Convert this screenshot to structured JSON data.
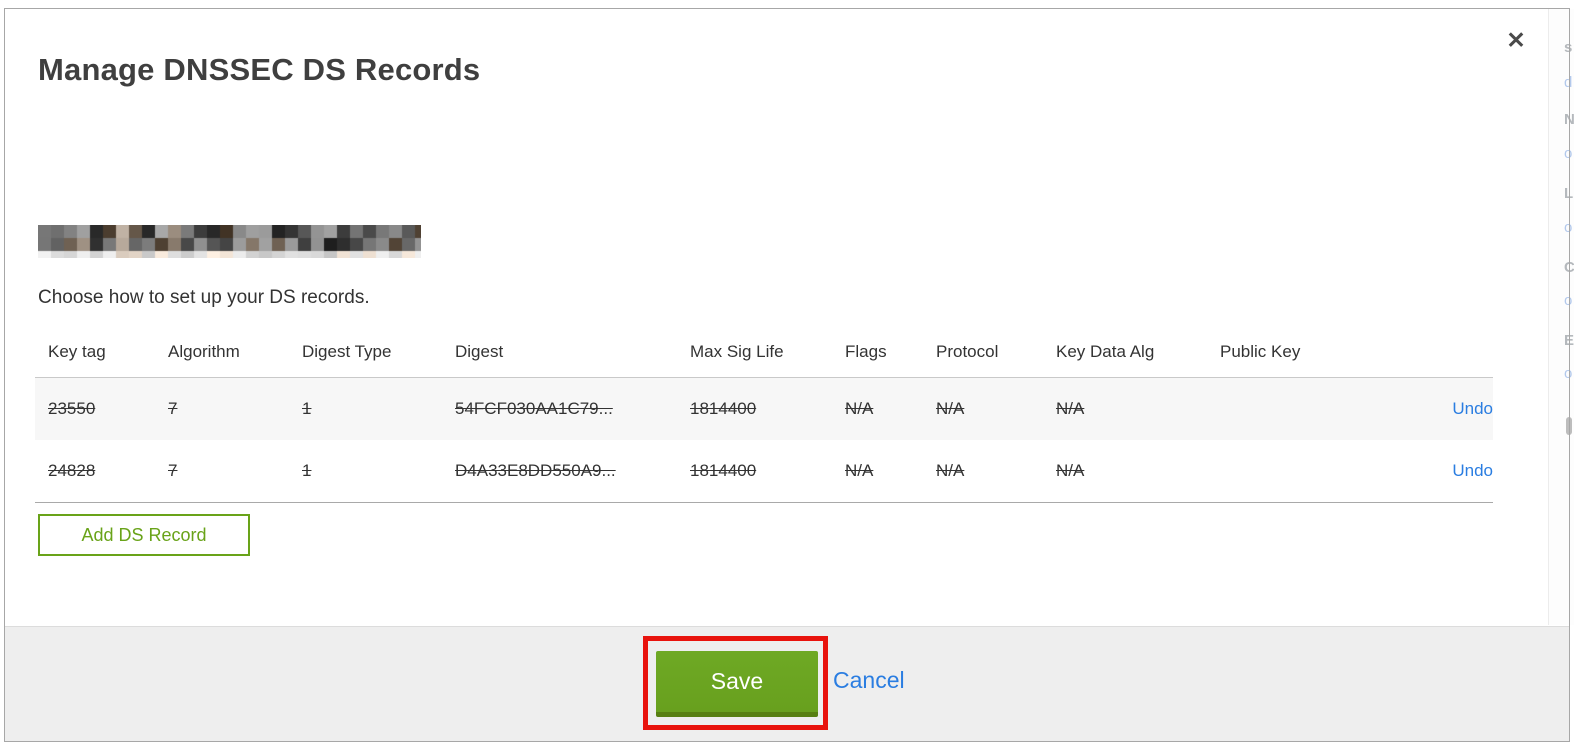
{
  "modal": {
    "title": "Manage DNSSEC DS Records",
    "close_label": "✕",
    "subtitle": "Choose how to set up your DS records.",
    "table": {
      "headers": [
        "Key tag",
        "Algorithm",
        "Digest Type",
        "Digest",
        "Max Sig Life",
        "Flags",
        "Protocol",
        "Key Data Alg",
        "Public Key",
        ""
      ],
      "rows": [
        {
          "cells": [
            "23550",
            "7",
            "1",
            "54FCF030AA1C79...",
            "1814400",
            "N/A",
            "N/A",
            "N/A",
            ""
          ],
          "action": "Undo",
          "deleted": true
        },
        {
          "cells": [
            "24828",
            "7",
            "1",
            "D4A33E8DD550A9...",
            "1814400",
            "N/A",
            "N/A",
            "N/A",
            ""
          ],
          "action": "Undo",
          "deleted": true
        }
      ]
    },
    "add_ds_record_label": "Add DS Record",
    "footer": {
      "save_label": "Save",
      "cancel_label": "Cancel"
    }
  },
  "colors": {
    "accent_green": "#69A319",
    "link_blue": "#2A7DE1",
    "annotation_red": "#E8130D",
    "footer_bg": "#EEEEEE",
    "row_alt_bg": "#F7F7F7"
  },
  "background_edge_fragments": [
    "s",
    "d",
    "N",
    "o",
    "L",
    "o",
    "C",
    "o",
    "E",
    "o"
  ]
}
